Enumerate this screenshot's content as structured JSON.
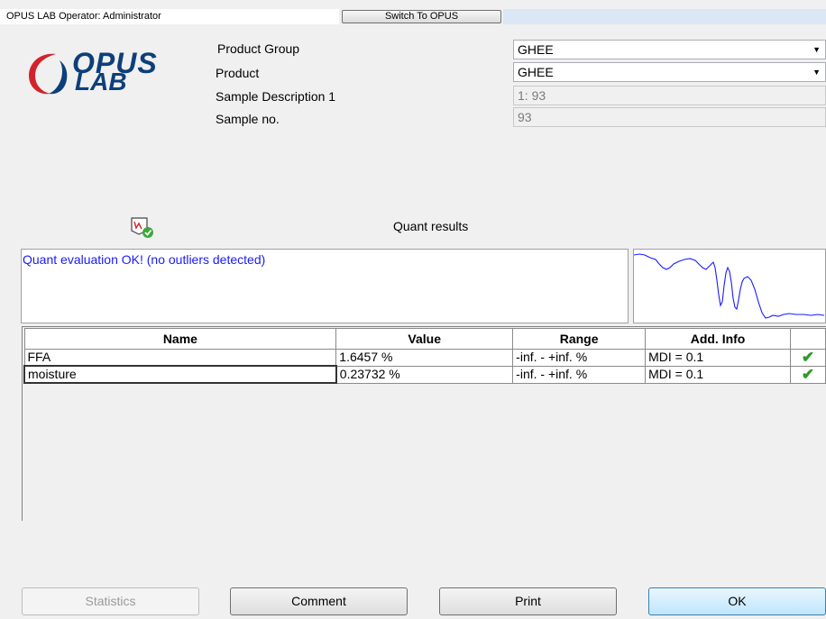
{
  "window": {
    "title": "OPUS LAB Operator: Administrator",
    "switch_button": "Switch To OPUS"
  },
  "logo": {
    "opus": "OPUS",
    "lab": "LAB"
  },
  "form": {
    "product_group": {
      "label": "Product Group",
      "value": "GHEE"
    },
    "product": {
      "label": "Product",
      "value": "GHEE"
    },
    "sample_description": {
      "label": "Sample Description 1",
      "value": "1: 93"
    },
    "sample_no": {
      "label": "Sample no.",
      "value": "93"
    }
  },
  "quant": {
    "heading": "Quant results",
    "status_message": "Quant evaluation OK! (no outliers detected)"
  },
  "table": {
    "headers": [
      "Name",
      "Value",
      "Range",
      "Add. Info",
      ""
    ],
    "rows": [
      {
        "name": "FFA",
        "value": "1.6457 %",
        "range": "-inf. - +inf. %",
        "info": "MDI = 0.1",
        "status": "check"
      },
      {
        "name": "moisture",
        "value": "0.23732 %",
        "range": "-inf. - +inf. %",
        "info": "MDI = 0.1",
        "status": "check"
      }
    ]
  },
  "buttons": {
    "statistics": "Statistics",
    "comment": "Comment",
    "print": "Print",
    "ok": "OK"
  },
  "colors": {
    "status_text": "#1a1aff",
    "spectrum_line": "#1a1aff",
    "check": "#2a9a2a",
    "logo_blue": "#0d3f7a",
    "logo_red": "#d2232a"
  }
}
